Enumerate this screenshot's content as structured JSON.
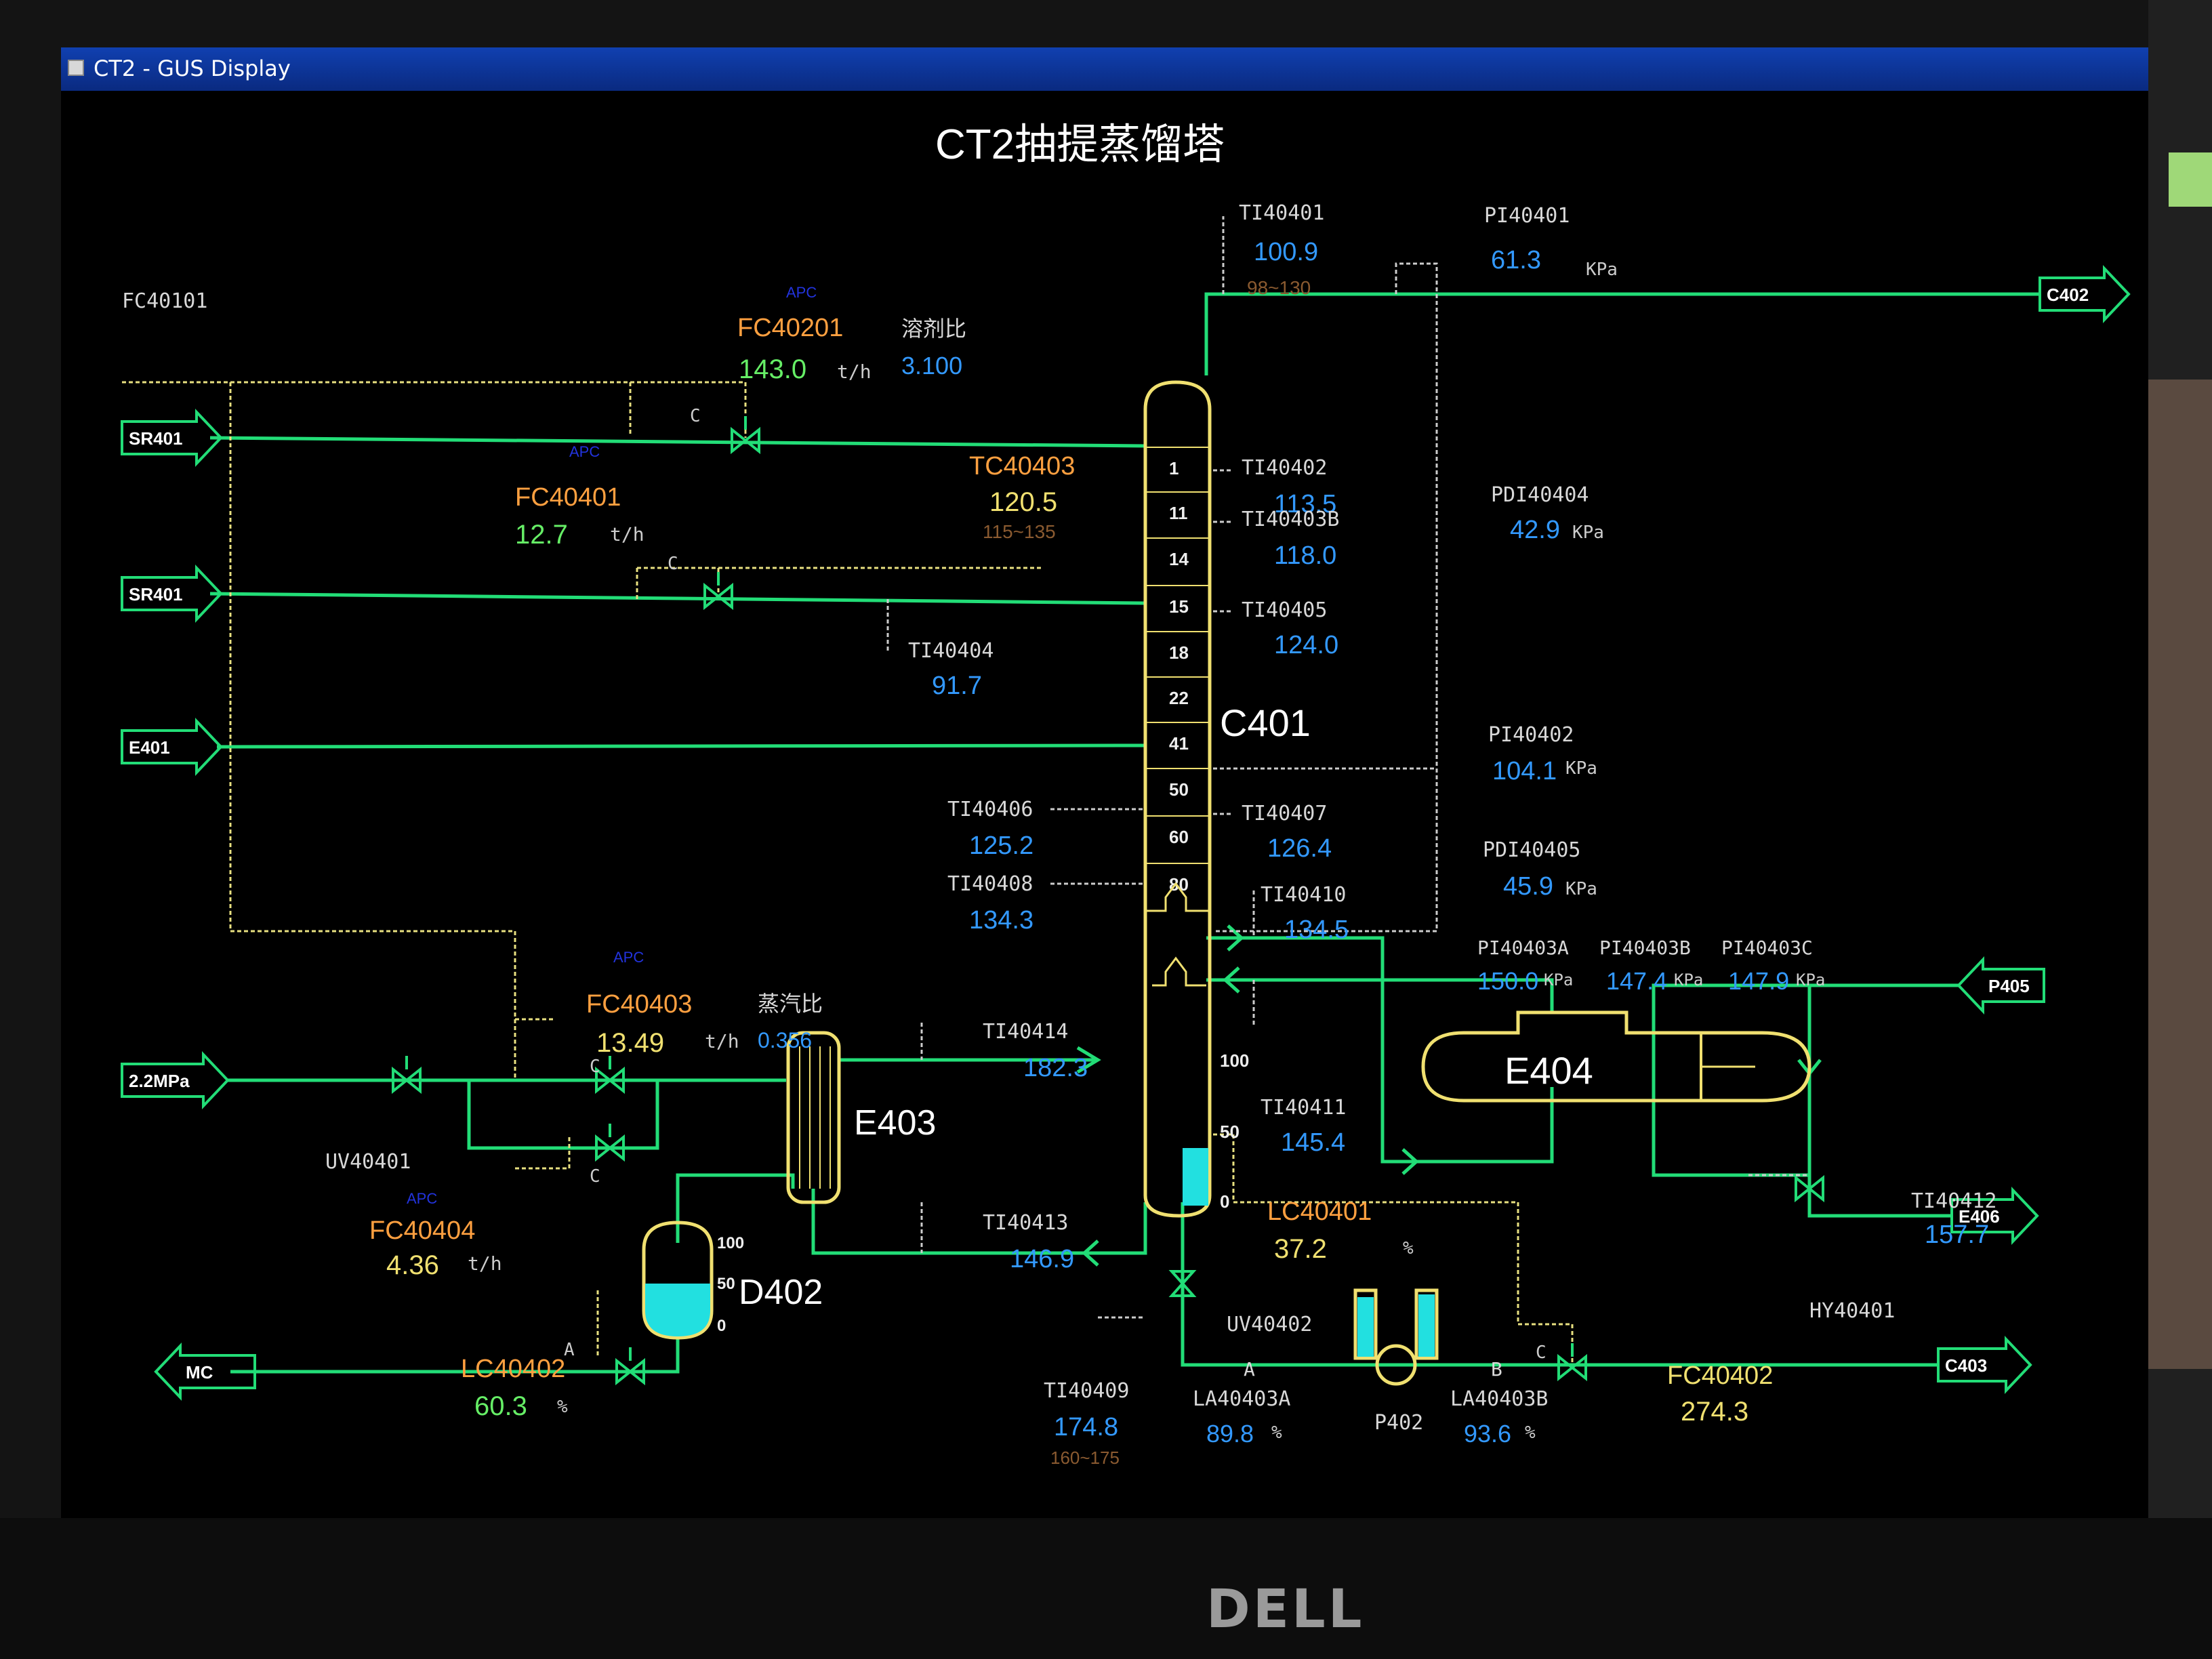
{
  "window": {
    "title": "CT2 - GUS Display"
  },
  "display_title": "CT2抽提蒸馏塔",
  "brand": "DELL",
  "column": {
    "name": "C401",
    "trays": [
      "1",
      "11",
      "14",
      "15",
      "18",
      "22",
      "41",
      "50",
      "60",
      "80"
    ],
    "level_scale": [
      "100",
      "50",
      "0"
    ]
  },
  "connectors": {
    "sr401_a": "SR401",
    "sr401_b": "SR401",
    "e401": "E401",
    "mpa": "2.2MPa",
    "mc": "MC",
    "c402": "C402",
    "p405": "P405",
    "e406": "E406",
    "c403": "C403"
  },
  "equipment": {
    "e403": "E403",
    "e404": "E404",
    "d402": "D402",
    "p402": "P402",
    "d402_scale": [
      "100",
      "50",
      "0"
    ]
  },
  "tags": {
    "fc40101": {
      "name": "FC40101"
    },
    "fc40201": {
      "apc": "APC",
      "name": "FC40201",
      "value": "143.0",
      "unit": "t/h",
      "c": "C"
    },
    "ratio_solvent": {
      "label": "溶剂比",
      "value": "3.100"
    },
    "fc40401": {
      "apc": "APC",
      "name": "FC40401",
      "value": "12.7",
      "unit": "t/h",
      "c": "C"
    },
    "tc40403": {
      "name": "TC40403",
      "value": "120.5",
      "range": "115~135"
    },
    "ti40404": {
      "name": "TI40404",
      "value": "91.7"
    },
    "ti40401": {
      "name": "TI40401",
      "value": "100.9",
      "range": "98~130"
    },
    "pi40401": {
      "name": "PI40401",
      "value": "61.3",
      "unit": "KPa"
    },
    "ti40402": {
      "name": "TI40402",
      "value": "113.5"
    },
    "ti40403b": {
      "name": "TI40403B",
      "value": "118.0"
    },
    "ti40405": {
      "name": "TI40405",
      "value": "124.0"
    },
    "pdi40404": {
      "name": "PDI40404",
      "value": "42.9",
      "unit": "KPa"
    },
    "pi40402": {
      "name": "PI40402",
      "value": "104.1",
      "unit": "KPa"
    },
    "ti40406": {
      "name": "TI40406",
      "value": "125.2"
    },
    "ti40407": {
      "name": "TI40407",
      "value": "126.4"
    },
    "pdi40405": {
      "name": "PDI40405",
      "value": "45.9",
      "unit": "KPa"
    },
    "ti40408": {
      "name": "TI40408",
      "value": "134.3"
    },
    "ti40410": {
      "name": "TI40410",
      "value": "134.5"
    },
    "pi40403a": {
      "name": "PI40403A",
      "value": "150.0",
      "unit": "KPa"
    },
    "pi40403b": {
      "name": "PI40403B",
      "value": "147.4",
      "unit": "KPa"
    },
    "pi40403c": {
      "name": "PI40403C",
      "value": "147.9",
      "unit": "KPa"
    },
    "fc40403": {
      "apc": "APC",
      "name": "FC40403",
      "value": "13.49",
      "unit": "t/h",
      "c": "C"
    },
    "ratio_steam": {
      "label": "蒸汽比",
      "value": "0.356"
    },
    "ti40414": {
      "name": "TI40414",
      "value": "182.3"
    },
    "ti40411": {
      "name": "TI40411",
      "value": "145.4"
    },
    "uv40401": {
      "name": "UV40401"
    },
    "fc40404": {
      "apc": "APC",
      "name": "FC40404",
      "value": "4.36",
      "unit": "t/h",
      "c": "C"
    },
    "ti40413": {
      "name": "TI40413",
      "value": "146.9"
    },
    "lc40401": {
      "name": "LC40401",
      "value": "37.2",
      "unit": "%"
    },
    "ti40412": {
      "name": "TI40412",
      "value": "157.7"
    },
    "hy40401": {
      "name": "HY40401"
    },
    "uv40402": {
      "name": "UV40402"
    },
    "lc40402": {
      "name": "LC40402",
      "value": "60.3",
      "unit": "%",
      "a": "A"
    },
    "ti40409": {
      "name": "TI40409",
      "value": "174.8",
      "range": "160~175"
    },
    "la40403a": {
      "tag": "A",
      "name": "LA40403A",
      "value": "89.8",
      "unit": "%"
    },
    "la40403b": {
      "tag": "B",
      "name": "LA40403B",
      "value": "93.6",
      "unit": "%"
    },
    "fc40402": {
      "name": "FC40402",
      "value": "274.3",
      "c": "C"
    }
  },
  "levels": {
    "c401_bottom_pct": 37.2,
    "d402_pct": 60.3,
    "la40403a_pct": 89.8,
    "la40403b_pct": 93.6
  },
  "colors": {
    "line_green": "#22dd77",
    "value_blue": "#3399ff",
    "tag_orange": "#ffa040",
    "equipment_yellow": "#f0e070",
    "level_cyan": "#22e0e0"
  }
}
